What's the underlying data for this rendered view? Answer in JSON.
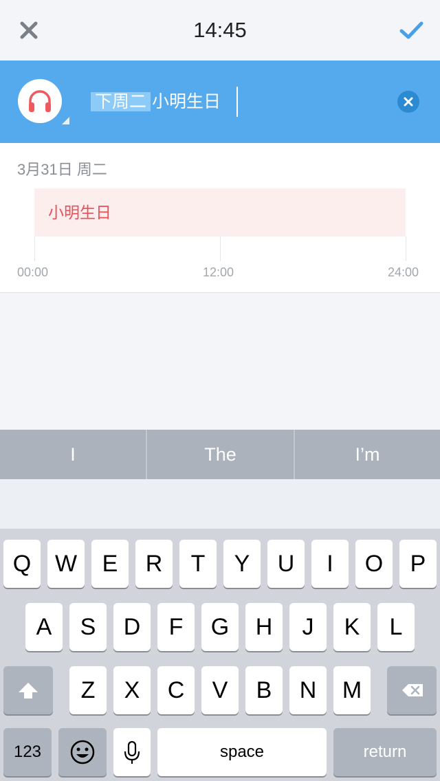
{
  "header": {
    "time": "14:45"
  },
  "input": {
    "highlight_text": "下周二",
    "text": "小明生日"
  },
  "event": {
    "date_label": "3月31日 周二",
    "title": "小明生日",
    "timeline_labels": [
      "00:00",
      "12:00",
      "24:00"
    ]
  },
  "suggestions": [
    "I",
    "The",
    "I’m"
  ],
  "keyboard": {
    "row1": [
      "Q",
      "W",
      "E",
      "R",
      "T",
      "Y",
      "U",
      "I",
      "O",
      "P"
    ],
    "row2": [
      "A",
      "S",
      "D",
      "F",
      "G",
      "H",
      "J",
      "K",
      "L"
    ],
    "row3": [
      "Z",
      "X",
      "C",
      "V",
      "B",
      "N",
      "M"
    ],
    "numbers_label": "123",
    "space_label": "space",
    "return_label": "return"
  },
  "colors": {
    "accent_blue": "#55aaee",
    "event_red": "#e8505a",
    "event_bg": "#fdeeee"
  }
}
